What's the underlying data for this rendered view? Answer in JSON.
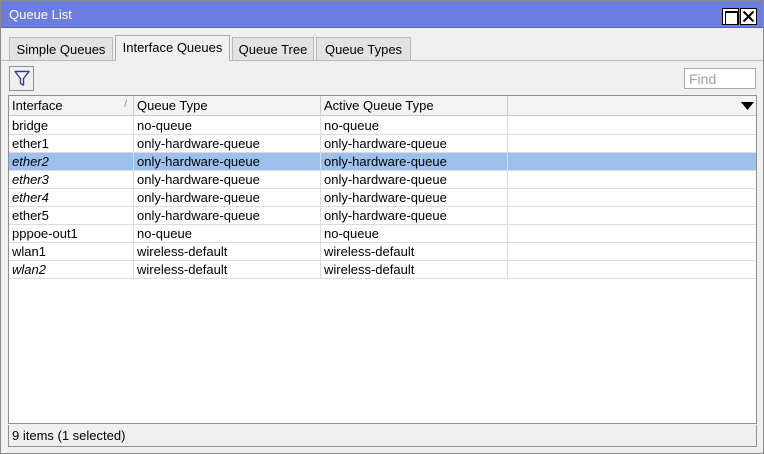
{
  "window": {
    "title": "Queue List"
  },
  "tabs": [
    {
      "label": "Simple Queues",
      "active": false
    },
    {
      "label": "Interface Queues",
      "active": true
    },
    {
      "label": "Queue Tree",
      "active": false
    },
    {
      "label": "Queue Types",
      "active": false
    }
  ],
  "toolbar": {
    "filter_icon": "filter-icon",
    "find_placeholder": "Find",
    "find_value": ""
  },
  "table": {
    "columns": [
      "Interface",
      "Queue Type",
      "Active Queue Type",
      ""
    ],
    "rows": [
      {
        "interface": "bridge",
        "queue_type": "no-queue",
        "active_queue_type": "no-queue",
        "italic": false,
        "selected": false
      },
      {
        "interface": "ether1",
        "queue_type": "only-hardware-queue",
        "active_queue_type": "only-hardware-queue",
        "italic": false,
        "selected": false
      },
      {
        "interface": "ether2",
        "queue_type": "only-hardware-queue",
        "active_queue_type": "only-hardware-queue",
        "italic": true,
        "selected": true
      },
      {
        "interface": "ether3",
        "queue_type": "only-hardware-queue",
        "active_queue_type": "only-hardware-queue",
        "italic": true,
        "selected": false
      },
      {
        "interface": "ether4",
        "queue_type": "only-hardware-queue",
        "active_queue_type": "only-hardware-queue",
        "italic": true,
        "selected": false
      },
      {
        "interface": "ether5",
        "queue_type": "only-hardware-queue",
        "active_queue_type": "only-hardware-queue",
        "italic": false,
        "selected": false
      },
      {
        "interface": "pppoe-out1",
        "queue_type": "no-queue",
        "active_queue_type": "no-queue",
        "italic": false,
        "selected": false
      },
      {
        "interface": "wlan1",
        "queue_type": "wireless-default",
        "active_queue_type": "wireless-default",
        "italic": false,
        "selected": false
      },
      {
        "interface": "wlan2",
        "queue_type": "wireless-default",
        "active_queue_type": "wireless-default",
        "italic": true,
        "selected": false
      }
    ]
  },
  "status": {
    "text": "9 items (1 selected)"
  },
  "colors": {
    "titlebar": "#6b7ee0",
    "selection": "#9ec0ec"
  }
}
